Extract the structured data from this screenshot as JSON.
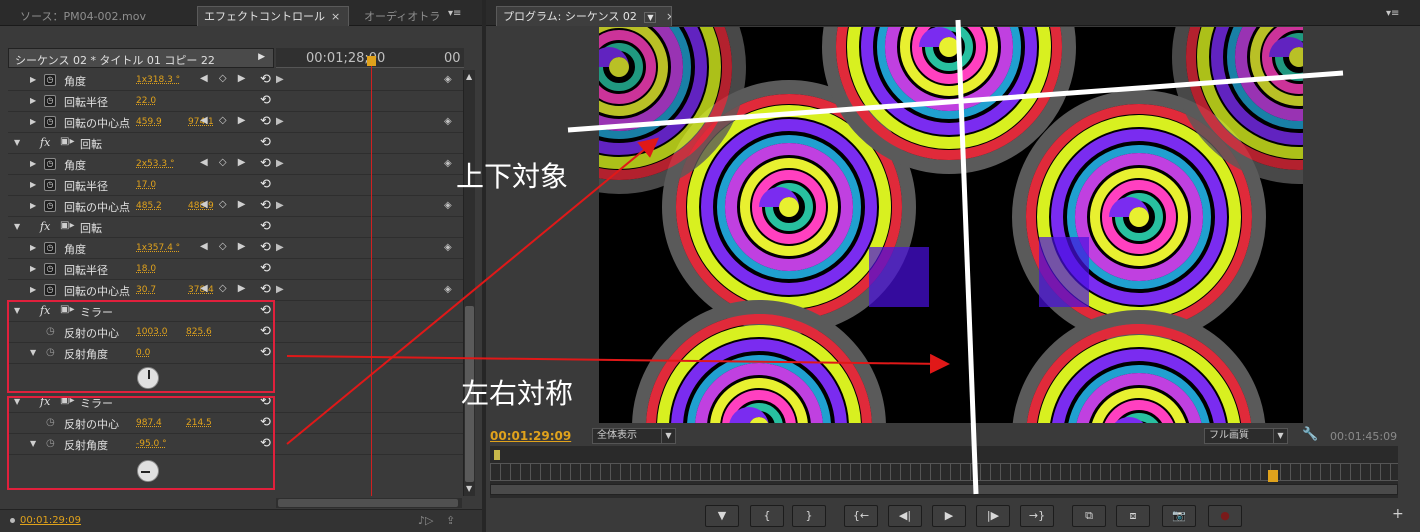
{
  "left_panel": {
    "tabs": [
      "ソース：PM04-002.mov",
      "エフェクトコントロール",
      "オーディオトラ"
    ],
    "close_glyph": "×",
    "menu_glyph": "▾≡",
    "sequence_label": "シーケンス 02 * タイトル 01 コピー 22",
    "ruler_time_left": "00:01;28;00",
    "ruler_time_right": "00",
    "current_time": "00:01:29:09",
    "rows": [
      {
        "kind": "param",
        "label": "角度",
        "v1": "1x318.3 °",
        "v2": "",
        "keys": "◀ ◇ ▶"
      },
      {
        "kind": "param",
        "label": "回転半径",
        "v1": "22.0",
        "v2": "",
        "keys": ""
      },
      {
        "kind": "param",
        "label": "回転の中心点",
        "v1": "459.9",
        "v2": "974.1",
        "keys": "◀ ◇ ▶"
      },
      {
        "kind": "effect",
        "label": "回転"
      },
      {
        "kind": "param",
        "label": "角度",
        "v1": "2x53.3 °",
        "v2": "",
        "keys": "◀ ◇ ▶"
      },
      {
        "kind": "param",
        "label": "回転半径",
        "v1": "17.0",
        "v2": "",
        "keys": ""
      },
      {
        "kind": "param",
        "label": "回転の中心点",
        "v1": "485.2",
        "v2": "488.9",
        "keys": "◀ ◇ ▶"
      },
      {
        "kind": "effect",
        "label": "回転"
      },
      {
        "kind": "param",
        "label": "角度",
        "v1": "1x357.4 °",
        "v2": "",
        "keys": "◀ ◇ ▶"
      },
      {
        "kind": "param",
        "label": "回転半径",
        "v1": "18.0",
        "v2": "",
        "keys": ""
      },
      {
        "kind": "param",
        "label": "回転の中心点",
        "v1": "30.7",
        "v2": "378.4",
        "keys": "◀ ◇ ▶"
      },
      {
        "kind": "effect",
        "label": "ミラー"
      },
      {
        "kind": "param2",
        "label": "反射の中心",
        "v1": "1003.0",
        "v2": "825.6"
      },
      {
        "kind": "param2",
        "label": "反射角度",
        "v1": "0.0",
        "v2": ""
      },
      {
        "kind": "effect",
        "label": "ミラー"
      },
      {
        "kind": "param2",
        "label": "反射の中心",
        "v1": "987.4",
        "v2": "214.5"
      },
      {
        "kind": "param2",
        "label": "反射角度",
        "v1": "-95.0 °",
        "v2": ""
      }
    ],
    "dial1_angle": 0.0,
    "dial2_angle": -95.0
  },
  "right_panel": {
    "tab": "プログラム: シーケンス 02",
    "close_glyph": "×",
    "menu_glyph": "▾≡",
    "current_time": "00:01:29:09",
    "zoom": "全体表示",
    "quality": "フル画質",
    "duration": "00:01:45:09",
    "transport": [
      "▼",
      "{",
      "}",
      "{←",
      "◀|",
      "▶",
      "|▶",
      "→}",
      "⧉",
      "⧈",
      "📷",
      "●"
    ]
  },
  "annotations": {
    "vertical": "上下対象",
    "horizontal": "左右対称"
  },
  "colors": {
    "accent": "#e0a21c",
    "highlight": "#e0203c",
    "arrow": "#e01818"
  }
}
